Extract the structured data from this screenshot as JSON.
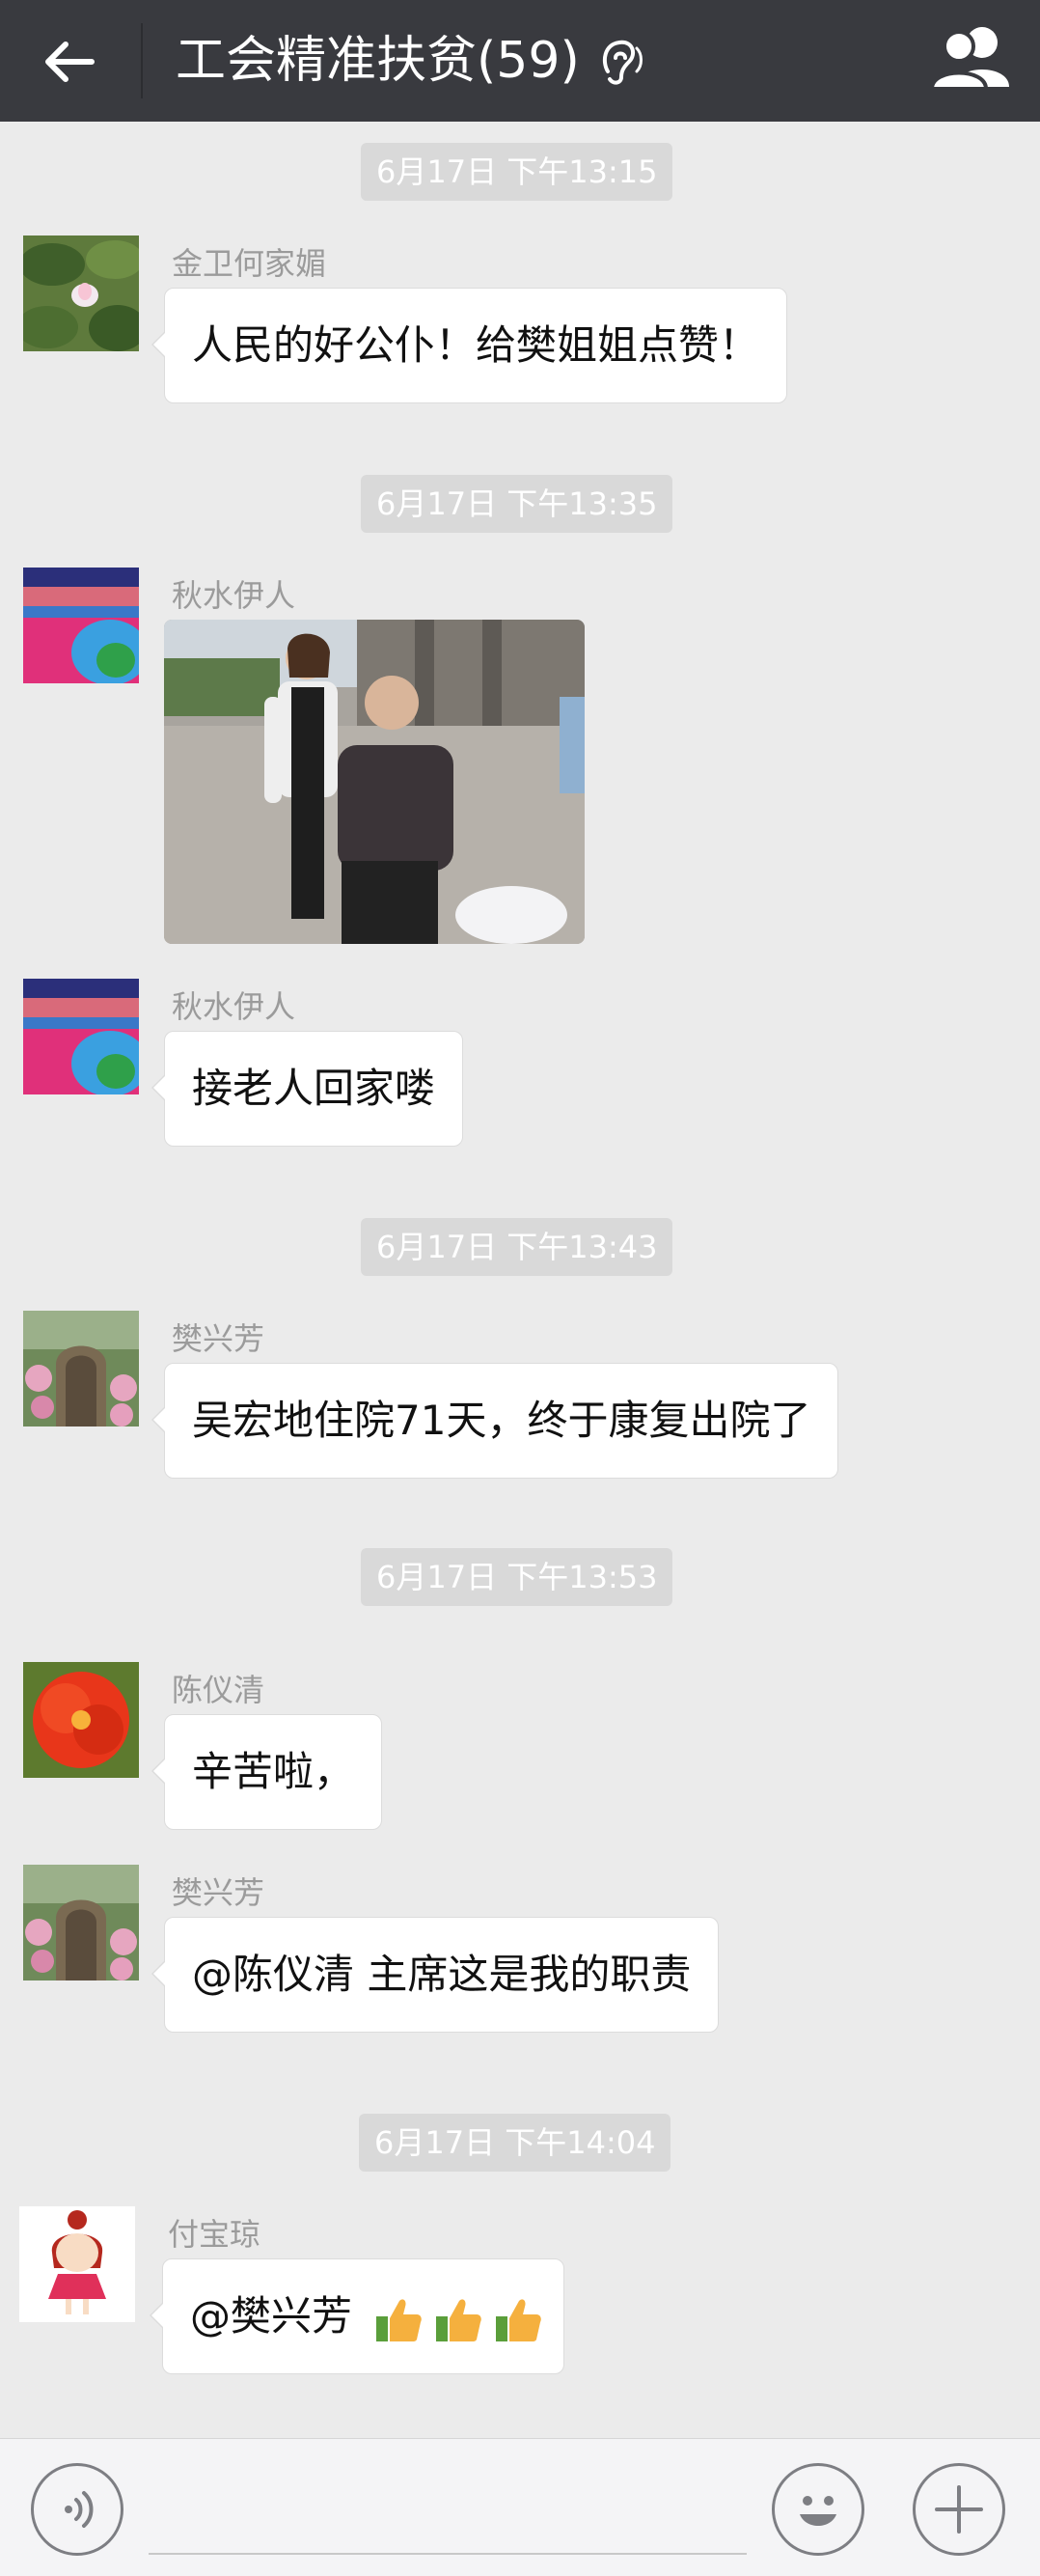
{
  "header": {
    "title": "工会精准扶贫(59)",
    "back_icon": "back-arrow-icon",
    "ear_icon": "earpiece-mode-icon",
    "members_icon": "group-members-icon"
  },
  "messages": [
    {
      "time": "6月17日 下午13:15"
    },
    {
      "sender": "金卫何家媚",
      "text": "人民的好公仆！给樊姐姐点赞！",
      "avatar": "lotus-avatar"
    },
    {
      "time": "6月17日 下午13:35"
    },
    {
      "sender": "秋水伊人",
      "type": "image",
      "image": "photo-two-people-street",
      "avatar": "flower-field-avatar"
    },
    {
      "sender": "秋水伊人",
      "text": "接老人回家喽",
      "avatar": "flower-field-avatar"
    },
    {
      "time": "6月17日 下午13:43"
    },
    {
      "sender": "樊兴芳",
      "text": "吴宏地住院71天，终于康复出院了",
      "avatar": "garden-gate-avatar"
    },
    {
      "time": "6月17日 下午13:53"
    },
    {
      "sender": "陈仪清",
      "text": "辛苦啦，",
      "avatar": "red-flower-avatar"
    },
    {
      "sender": "樊兴芳",
      "text": "@陈仪清 主席这是我的职责",
      "avatar": "garden-gate-avatar"
    },
    {
      "time": "6月17日 下午14:04"
    },
    {
      "sender": "付宝琼",
      "text": "@樊兴芳 ",
      "emoji": [
        "thumbs-up-emoji",
        "thumbs-up-emoji",
        "thumbs-up-emoji"
      ],
      "avatar": "cartoon-girl-avatar"
    }
  ],
  "input_bar": {
    "voice_icon": "voice-input-icon",
    "emoji_icon": "emoji-smiley-icon",
    "plus_icon": "plus-more-icon"
  }
}
